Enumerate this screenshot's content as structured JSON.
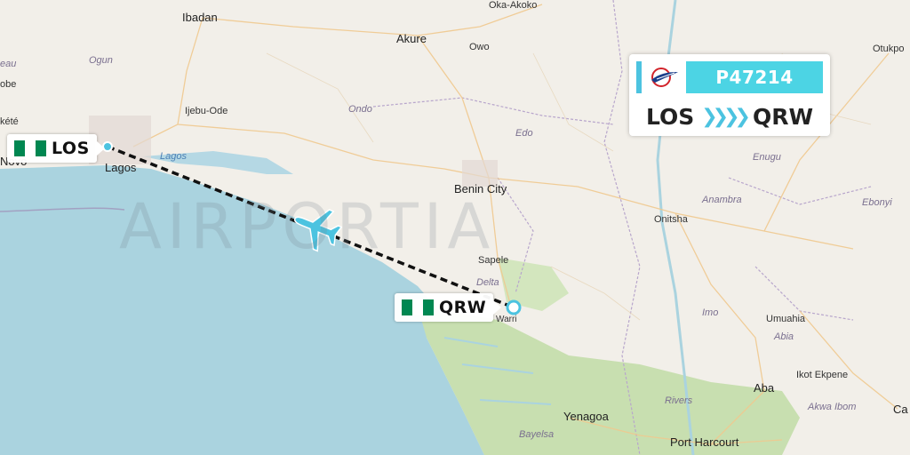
{
  "flight": {
    "number": "P47214",
    "origin": "LOS",
    "destination": "QRW",
    "route_arrows": "❯❯❯❯"
  },
  "watermark": "AIRPORTIA",
  "airports": {
    "origin": {
      "code": "LOS",
      "flag_colors": [
        "#008751",
        "#ffffff",
        "#008751"
      ]
    },
    "destination": {
      "code": "QRW",
      "flag_colors": [
        "#008751",
        "#ffffff",
        "#008751"
      ]
    }
  },
  "places": {
    "ibadan": "Ibadan",
    "oka_akoko": "Oka-Akoko",
    "akure": "Akure",
    "owo": "Owo",
    "otukpo": "Otukpo",
    "ogun": "Ogun",
    "ijebu_ode": "Ijebu-Ode",
    "ondo": "Ondo",
    "edo": "Edo",
    "lagos_city": "Lagos",
    "lagos_lagoon": "Lagos",
    "novo": "Novo",
    "kete": "kété",
    "eau": "eau",
    "obe": "obe",
    "benin_city": "Benin City",
    "enugu": "Enugu",
    "anambra": "Anambra",
    "onitsha": "Onitsha",
    "ebonyi": "Ebonyi",
    "sapele": "Sapele",
    "delta": "Delta",
    "warri": "Warri",
    "imo": "Imo",
    "umuahia": "Umuahia",
    "abia": "Abia",
    "ikot_ekpene": "Ikot Ekpene",
    "aba": "Aba",
    "akwa_ibom": "Akwa Ibom",
    "rivers": "Rivers",
    "yenagoa": "Yenagoa",
    "bayelsa": "Bayelsa",
    "port_harcourt": "Port Harcourt",
    "ca": "Ca"
  },
  "colors": {
    "accent": "#4cd4e4",
    "sea": "#aad3df",
    "land": "#f2efe9",
    "forest": "#c8dfb0",
    "route": "#111111"
  }
}
